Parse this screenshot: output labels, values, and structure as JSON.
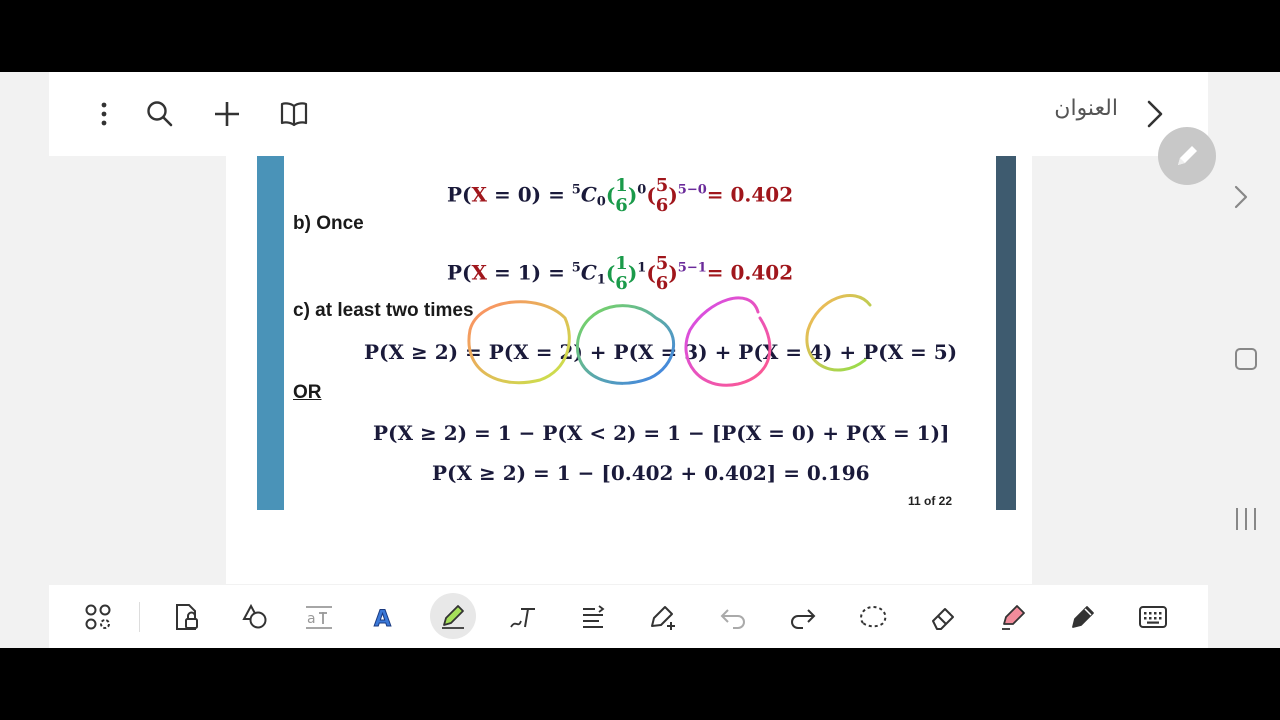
{
  "header": {
    "title": "العنوان",
    "icons": [
      "more-vertical-icon",
      "search-icon",
      "plus-icon",
      "book-open-icon",
      "chevron-right-icon"
    ]
  },
  "document": {
    "lines": [
      {
        "id": "p0",
        "text": "P(X = 0) =  ⁵C₀(1/6)⁰(5/6)⁵⁻⁰= 0.402"
      },
      {
        "id": "b_label",
        "text": "b)   Once"
      },
      {
        "id": "p1",
        "text": "P(X = 1) =  ⁵C₁(1/6)¹(5/6)⁵⁻¹= 0.402"
      },
      {
        "id": "c_label",
        "text": "c)   at least two times"
      },
      {
        "id": "pge2",
        "text": "P(X ≥ 2) = P(X = 2) + P(X = 3) + P(X = 4) + P(X = 5)"
      },
      {
        "id": "or",
        "text": "OR"
      },
      {
        "id": "pge2b",
        "text": "P(X ≥ 2) = 1 − P(X < 2) = 1 − [P(X = 0) + P(X = 1)]"
      },
      {
        "id": "pge2c",
        "text": "P(X ≥ 2) = 1 − [0.402 + 0.402] = 0.196"
      }
    ],
    "page_indicator": "11 of 22"
  },
  "toolbar": {
    "tools": [
      "apps-icon",
      "lock-page-icon",
      "shapes-icon",
      "text-size-icon",
      "text-style-icon",
      "highlighter-icon",
      "handwriting-icon",
      "align-icon",
      "lasso-pen-icon",
      "undo-icon",
      "redo-icon",
      "lasso-select-icon",
      "eraser-icon",
      "marker-icon",
      "pen-icon",
      "keyboard-icon"
    ]
  },
  "nav": {
    "icons": [
      "chevron-right-icon",
      "home-square-icon",
      "recent-apps-icon"
    ]
  },
  "colors": {
    "accent_left": "#4a93b8",
    "accent_right": "#3e5b6f",
    "math_red": "#a0161c"
  }
}
